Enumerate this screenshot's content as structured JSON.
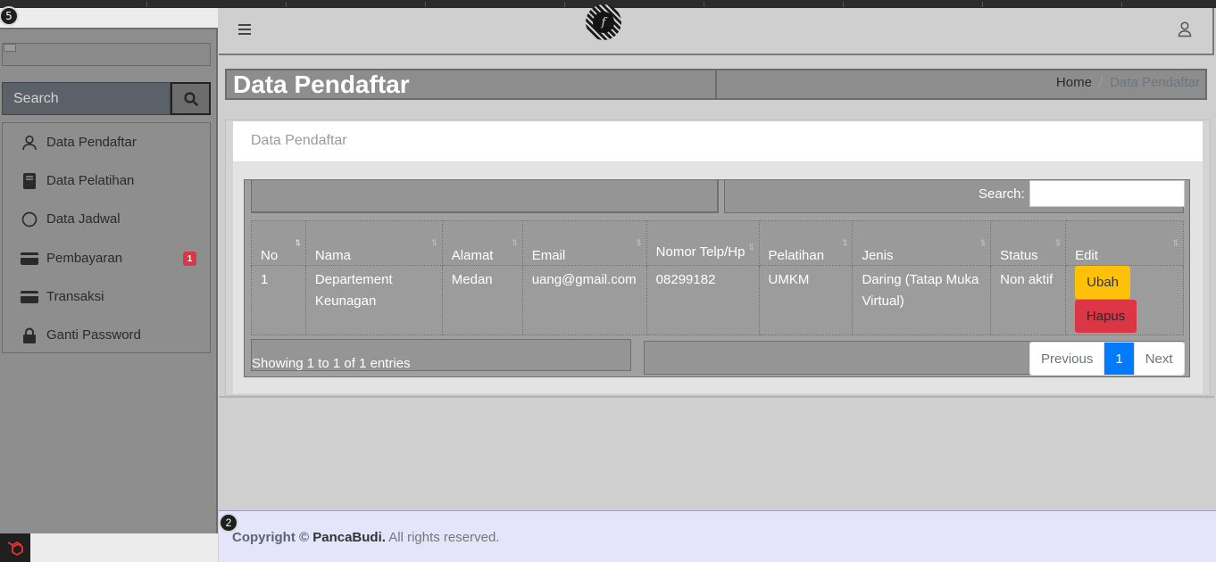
{
  "overlay_badges": {
    "sidebar": "5",
    "footer": "2"
  },
  "sidebar": {
    "search_placeholder": "Search",
    "items": [
      {
        "label": "Data Pendaftar",
        "icon": "user-icon"
      },
      {
        "label": "Data Pelatihan",
        "icon": "book-icon"
      },
      {
        "label": "Data Jadwal",
        "icon": "circle-icon"
      },
      {
        "label": "Pembayaran",
        "icon": "credit-card-icon",
        "badge": "1"
      },
      {
        "label": "Transaksi",
        "icon": "credit-card-icon"
      },
      {
        "label": "Ganti Password",
        "icon": "lock-icon"
      }
    ]
  },
  "navbar": {
    "logo_letter": "f"
  },
  "header": {
    "title": "Data Pendaftar",
    "breadcrumb": {
      "home": "Home",
      "separator": "/",
      "current": "Data Pendaftar"
    }
  },
  "card": {
    "title": "Data Pendaftar"
  },
  "table": {
    "search_label": "Search:",
    "columns": [
      "No",
      "Nama",
      "Alamat",
      "Email",
      "Nomor Telp/Hp",
      "Pelatihan",
      "Jenis",
      "Status",
      "Edit"
    ],
    "rows": [
      {
        "no": "1",
        "nama": "Departement Keunagan",
        "alamat": "Medan",
        "email": "uang@gmail.com",
        "telp": "08299182",
        "pelatihan": "UMKM",
        "jenis": "Daring (Tatap Muka Virtual)",
        "status": "Non aktif",
        "edit_label": "Ubah",
        "delete_label": "Hapus"
      }
    ],
    "info": "Showing 1 to 1 of 1 entries",
    "pagination": {
      "previous": "Previous",
      "current": "1",
      "next": "Next"
    }
  },
  "footer": {
    "prefix": "Copyright ©",
    "brand": "PancaBudi.",
    "suffix": "All rights reserved."
  },
  "colors": {
    "accent": "#007bff",
    "warning": "#ffc107",
    "danger": "#dc3545",
    "footer_bg": "#e4e4fa"
  }
}
